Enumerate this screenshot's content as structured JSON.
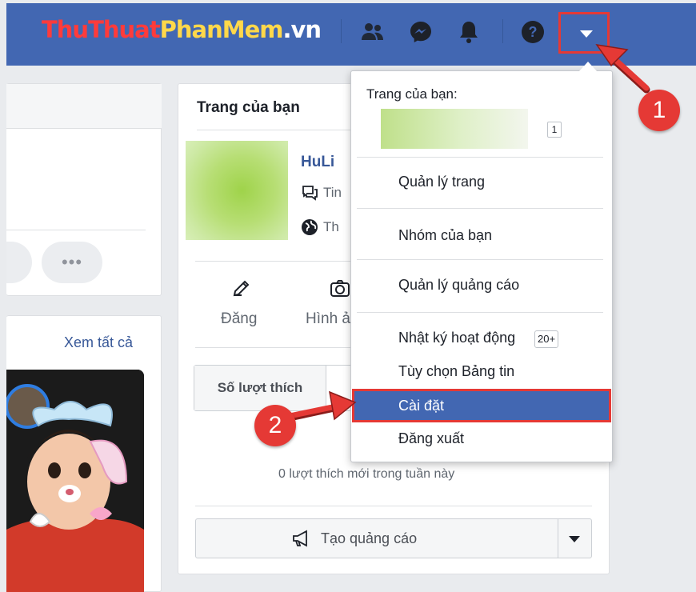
{
  "topbar": {
    "logo_part1": "Thu",
    "logo_part2": "Thuat",
    "logo_part3": "PhanMem",
    "logo_part4": ".vn"
  },
  "left": {
    "see_all": "Xem tất cả"
  },
  "page_panel": {
    "title": "Trang của bạn",
    "page_name": "HuLi",
    "meta1": "Tin",
    "meta2": "Th",
    "action_post": "Đăng",
    "action_photo": "Hình ả",
    "tab_likes": "Số lượt thích",
    "likes_note": "0 lượt thích mới trong tuần này",
    "create_ad": "Tạo quảng cáo"
  },
  "menu": {
    "your_pages_label": "Trang của bạn:",
    "page_badge": "1",
    "items": [
      {
        "label": "Quản lý trang"
      },
      {
        "label": "Nhóm của bạn"
      },
      {
        "label": "Quản lý quảng cáo"
      },
      {
        "label": "Nhật ký hoạt động",
        "badge": "20+"
      },
      {
        "label": "Tùy chọn Bảng tin"
      },
      {
        "label": "Cài đặt"
      },
      {
        "label": "Đăng xuất"
      }
    ]
  },
  "annotations": {
    "step1": "1",
    "step2": "2",
    "color": "#e53935"
  },
  "colors": {
    "topbar": "#4267b2",
    "link": "#385898",
    "highlight": "#4267b2"
  }
}
